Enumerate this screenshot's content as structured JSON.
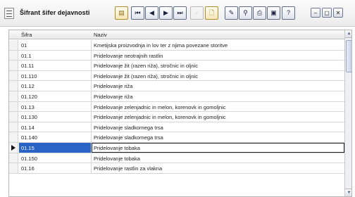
{
  "toolbar": {
    "title": "Šifrant šifer dejavnosti",
    "buttons": [
      {
        "icon": "document-icon",
        "glyph": "▤"
      },
      {
        "icon": "first-record-icon",
        "glyph": "⏮"
      },
      {
        "icon": "previous-record-icon",
        "glyph": "◀"
      },
      {
        "icon": "next-record-icon",
        "glyph": "▶"
      },
      {
        "icon": "last-record-icon",
        "glyph": "⏭"
      },
      {
        "icon": "check-icon",
        "glyph": "✓"
      },
      {
        "icon": "new-document-icon",
        "glyph": "🗋"
      },
      {
        "icon": "edit-icon",
        "glyph": "✎"
      },
      {
        "icon": "search-icon",
        "glyph": "⚲"
      },
      {
        "icon": "print-icon",
        "glyph": "⎙"
      },
      {
        "icon": "preview-icon",
        "glyph": "▣"
      },
      {
        "icon": "help-icon",
        "glyph": "?"
      }
    ],
    "window_controls": [
      {
        "icon": "minimize-icon",
        "glyph": "–"
      },
      {
        "icon": "restore-icon",
        "glyph": "▢"
      },
      {
        "icon": "close-icon",
        "glyph": "✕"
      }
    ]
  },
  "grid": {
    "columns": [
      "Šifra",
      "Naziv"
    ],
    "rows": [
      {
        "sifra": "01",
        "naziv": "Kmetijska proizvodnja in lov ter z njima povezane storitve"
      },
      {
        "sifra": "01.1",
        "naziv": "Pridelovanje neotrajnih rastlin"
      },
      {
        "sifra": "01.11",
        "naziv": "Pridelovanje žit (razen riža), stročnic in oljnic"
      },
      {
        "sifra": "01.110",
        "naziv": "Pridelovanje žit (razen riža), stročnic in oljnic"
      },
      {
        "sifra": "01.12",
        "naziv": "Pridelovanje riža"
      },
      {
        "sifra": "01.120",
        "naziv": "Pridelovanje riža"
      },
      {
        "sifra": "01.13",
        "naziv": "Pridelovanje zelenjadnic in melon, korenovk in gomoljnic"
      },
      {
        "sifra": "01.130",
        "naziv": "Pridelovanje zelenjadnic in melon, korenovk in gomoljnic"
      },
      {
        "sifra": "01.14",
        "naziv": "Pridelovanje sladkornega trsa"
      },
      {
        "sifra": "01.140",
        "naziv": "Pridelovanje sladkornega trsa"
      },
      {
        "sifra": "01.15",
        "naziv": "Pridelovanje tobaka",
        "active": true
      },
      {
        "sifra": "01.150",
        "naziv": "Pridelovanje tobaka"
      },
      {
        "sifra": "01.16",
        "naziv": "Pridelovanje rastlin za vlakna"
      }
    ]
  },
  "colors": {
    "selection": "#2a63c6",
    "toolbar_bg": "#ececec",
    "grid_line": "#d6d6d6"
  }
}
